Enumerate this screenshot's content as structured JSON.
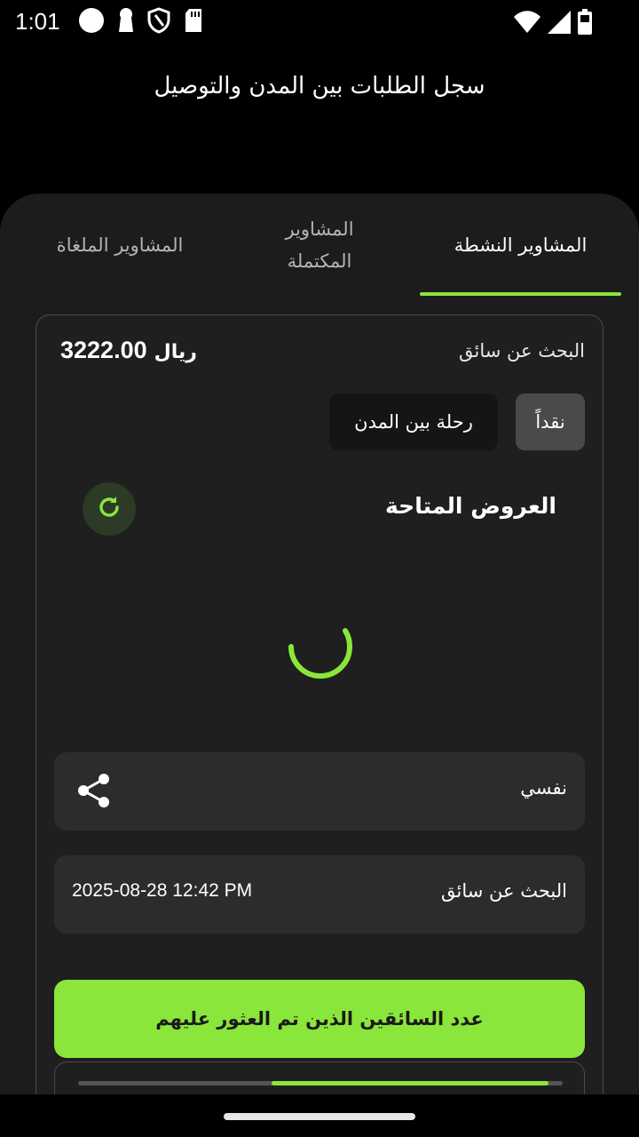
{
  "status_bar": {
    "time": "1:01",
    "icons": [
      "circle-icon",
      "keyhole-icon",
      "shield-icon",
      "sd-card-icon",
      "wifi-icon",
      "signal-icon",
      "battery-icon"
    ]
  },
  "header": {
    "title": "سجل الطلبات بين المدن والتوصيل"
  },
  "tabs": [
    {
      "label": "المشاوير النشطة",
      "active": true
    },
    {
      "label": "المشاوير المكتملة",
      "active": false
    },
    {
      "label": "المشاوير الملغاة",
      "active": false
    }
  ],
  "colors": {
    "accent": "#8ae63a",
    "background": "#000000",
    "sheet": "#1c1c1c",
    "card": "#1f1f1f",
    "row": "#2c2c2c"
  },
  "ride": {
    "status": "البحث عن سائق",
    "price_amount": "3222.00",
    "price_currency": "ريال",
    "payment_chip": "نقداً",
    "type_chip": "رحلة بين المدن",
    "offers_title": "العروض المتاحة",
    "refresh_icon": "refresh-icon",
    "loading": true,
    "passenger": "نفسي",
    "share_icon": "share-icon",
    "status_row_label": "البحث عن سائق",
    "datetime": "2025-08-28 12:42 PM",
    "drivers_found_label": "عدد السائقين الذين تم العثور عليهم",
    "progress_start": 0.4,
    "progress_end": 0.97
  }
}
